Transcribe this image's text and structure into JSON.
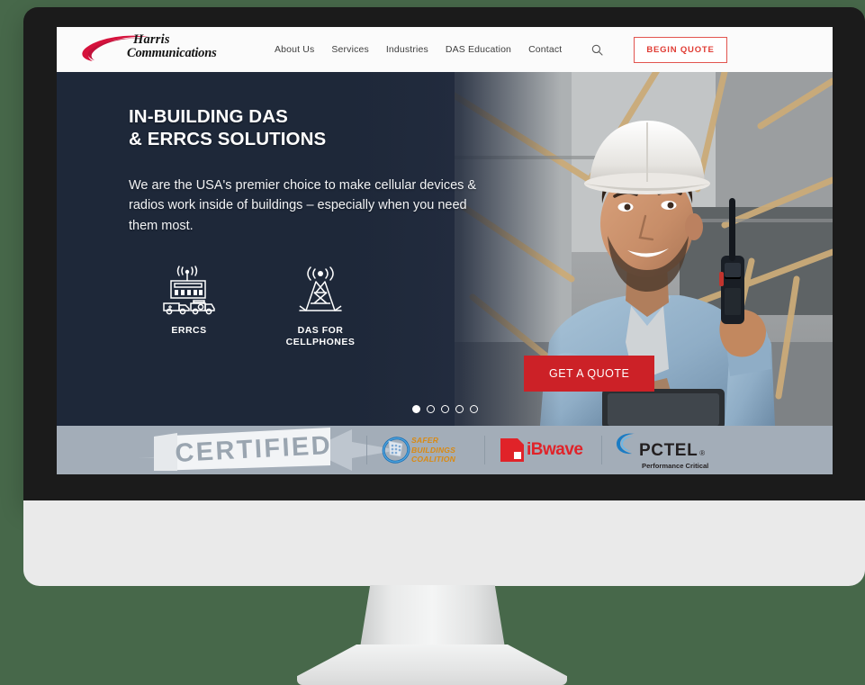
{
  "site": {
    "logo": {
      "line1": "Harris",
      "line2": "Communications",
      "swoosh_color": "#d6123c"
    },
    "nav": [
      {
        "label": "About Us"
      },
      {
        "label": "Services"
      },
      {
        "label": "Industries"
      },
      {
        "label": "DAS Education"
      },
      {
        "label": "Contact"
      }
    ],
    "search_icon": "search-icon",
    "begin_quote_label": "BEGIN QUOTE"
  },
  "hero": {
    "title_line1": "IN-BUILDING DAS",
    "title_line2": "& ERRCS SOLUTIONS",
    "subtitle": "We are the USA's premier choice to make cellular devices & radios work inside of buildings – especially when you need them most.",
    "features": [
      {
        "icon": "school-ambulance-signal-icon",
        "label": "ERRCS"
      },
      {
        "icon": "cell-tower-signal-icon",
        "label": "DAS FOR\nCELLPHONES"
      }
    ],
    "cta_label": "GET A QUOTE",
    "carousel": {
      "total": 5,
      "active_index": 0
    },
    "accent_color": "#e01d1d",
    "cta_color": "#cc2127",
    "background_color": "#222d42"
  },
  "certifications": {
    "bar_color": "#a3adb8",
    "banner_text": "CERTIFIED",
    "logos": [
      {
        "name": "safer-buildings-coalition",
        "line1": "SAFER",
        "line2": "BUILDINGS",
        "line3": "COALITION",
        "color": "#d98a13"
      },
      {
        "name": "ibwave",
        "text": "iBwave",
        "color": "#e02329"
      },
      {
        "name": "pctel",
        "text": "PCTEL",
        "registered": "®",
        "tagline": "Performance Critical",
        "color": "#231f20"
      }
    ]
  },
  "device": {
    "type": "desktop-monitor",
    "bezel_color": "#1b1b1b",
    "chin_color": "#eaeaea"
  },
  "page_background_color": "#47684a"
}
